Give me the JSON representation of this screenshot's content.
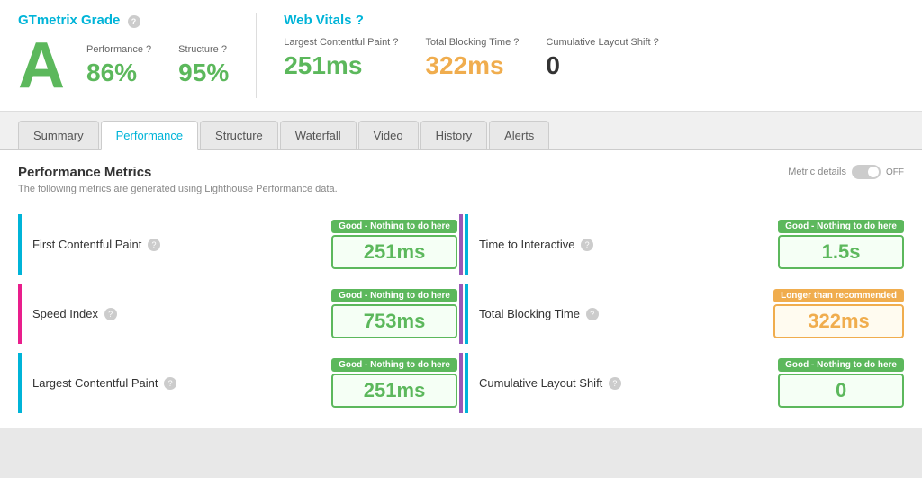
{
  "gtmetrix": {
    "title": "GTmetrix Grade",
    "grade": "A",
    "performance_label": "Performance",
    "performance_value": "86%",
    "structure_label": "Structure",
    "structure_value": "95%"
  },
  "webvitals": {
    "title": "Web Vitals",
    "metrics": [
      {
        "label": "Largest Contentful Paint",
        "value": "251ms",
        "color": "green"
      },
      {
        "label": "Total Blocking Time",
        "value": "322ms",
        "color": "orange"
      },
      {
        "label": "Cumulative Layout Shift",
        "value": "0",
        "color": "dark"
      }
    ]
  },
  "tabs": [
    {
      "label": "Summary",
      "active": false
    },
    {
      "label": "Performance",
      "active": true
    },
    {
      "label": "Structure",
      "active": false
    },
    {
      "label": "Waterfall",
      "active": false
    },
    {
      "label": "Video",
      "active": false
    },
    {
      "label": "History",
      "active": false
    },
    {
      "label": "Alerts",
      "active": false
    }
  ],
  "performance": {
    "title": "Performance Metrics",
    "subtitle": "The following metrics are generated using Lighthouse Performance data.",
    "metric_details_label": "Metric details",
    "toggle_state": "OFF",
    "metrics_left": [
      {
        "name": "First Contentful Paint",
        "badge": "Good - Nothing to do here",
        "badge_type": "green",
        "value": "251ms",
        "value_color": "green",
        "border": "blue"
      },
      {
        "name": "Speed Index",
        "badge": "Good - Nothing to do here",
        "badge_type": "green",
        "value": "753ms",
        "value_color": "green",
        "border": "pink"
      },
      {
        "name": "Largest Contentful Paint",
        "badge": "Good - Nothing to do here",
        "badge_type": "green",
        "value": "251ms",
        "value_color": "green",
        "border": "blue"
      }
    ],
    "metrics_right": [
      {
        "name": "Time to Interactive",
        "badge": "Good - Nothing to do here",
        "badge_type": "green",
        "value": "1.5s",
        "value_color": "green",
        "border": "blue"
      },
      {
        "name": "Total Blocking Time",
        "badge": "Longer than recommended",
        "badge_type": "orange",
        "value": "322ms",
        "value_color": "orange",
        "border": "blue"
      },
      {
        "name": "Cumulative Layout Shift",
        "badge": "Good - Nothing to do here",
        "badge_type": "green",
        "value": "0",
        "value_color": "green",
        "border": "blue"
      }
    ]
  }
}
